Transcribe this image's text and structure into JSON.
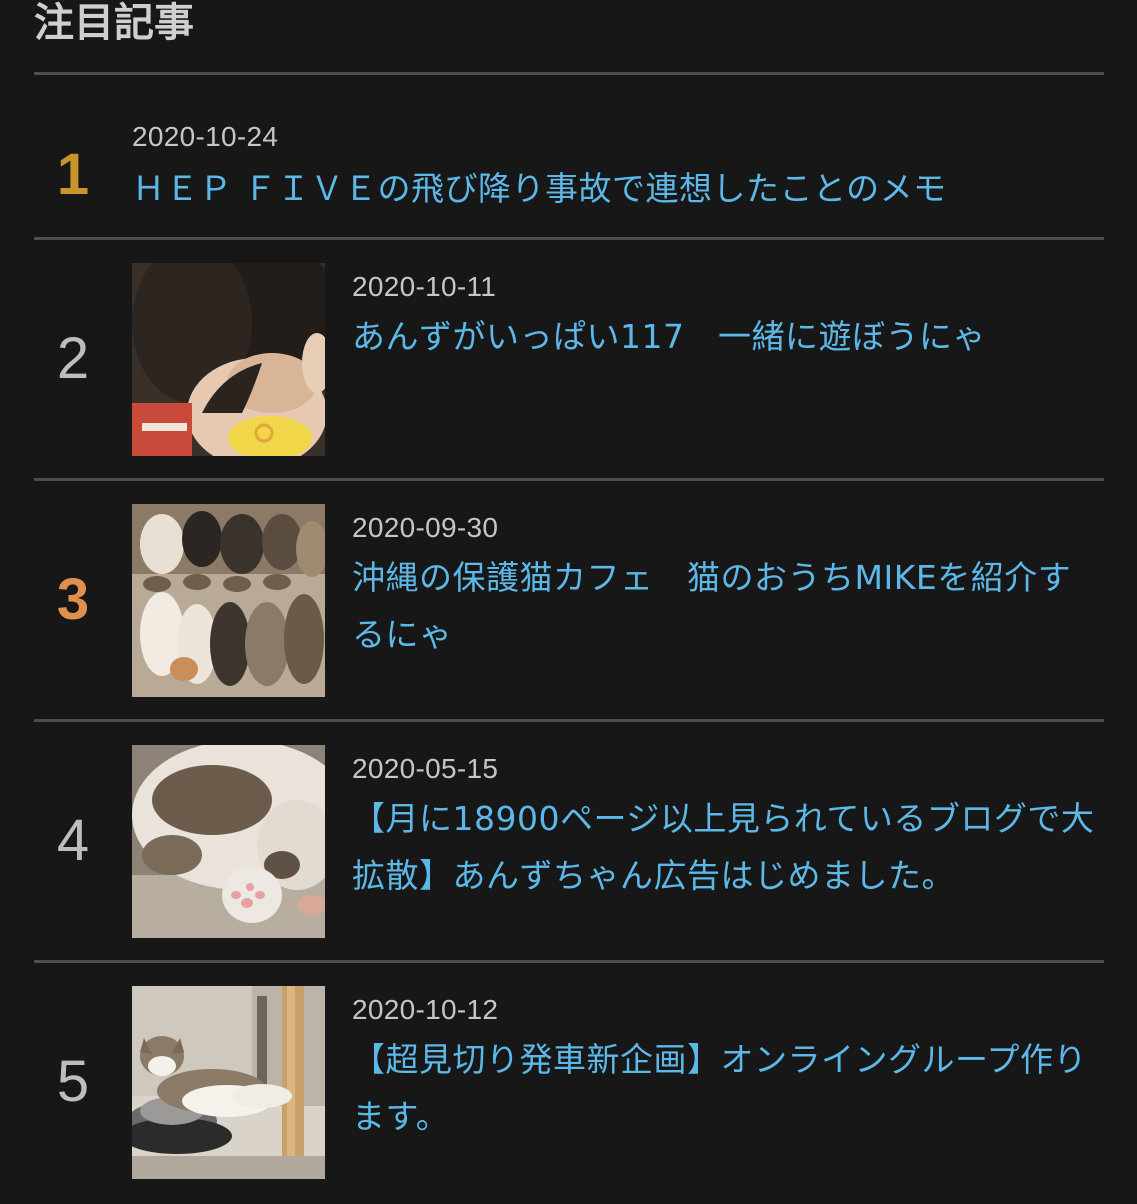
{
  "section": {
    "title": "注目記事"
  },
  "articles": [
    {
      "rank": "1",
      "date": "2020-10-24",
      "title": "ＨＥＰ ＦＩＶＥの飛び降り事故で連想したことのメモ",
      "has_thumbnail": false,
      "rank_color": "#c8952a"
    },
    {
      "rank": "2",
      "date": "2020-10-11",
      "title": "あんずがいっぱい117　一緒に遊ぼうにゃ",
      "has_thumbnail": true,
      "thumbnail": "child-and-baby-photo",
      "rank_color": "#bdbdbd"
    },
    {
      "rank": "3",
      "date": "2020-09-30",
      "title": "沖縄の保護猫カフェ　猫のおうちMIKEを紹介するにゃ",
      "has_thumbnail": true,
      "thumbnail": "cats-eating-photo",
      "rank_color": "#e0904e"
    },
    {
      "rank": "4",
      "date": "2020-05-15",
      "title": "【月に18900ページ以上見られているブログで大拡散】あんずちゃん広告はじめました。",
      "has_thumbnail": true,
      "thumbnail": "cat-lying-paw-photo",
      "rank_color": "#bdbdbd"
    },
    {
      "rank": "5",
      "date": "2020-10-12",
      "title": "【超見切り発車新企画】オンライングループ作ります。",
      "has_thumbnail": true,
      "thumbnail": "cat-on-cushion-photo",
      "rank_color": "#bdbdbd"
    }
  ],
  "colors": {
    "background": "#171717",
    "link": "#5cb8e8",
    "divider": "#4a4f55",
    "date": "#c6c6c6"
  }
}
